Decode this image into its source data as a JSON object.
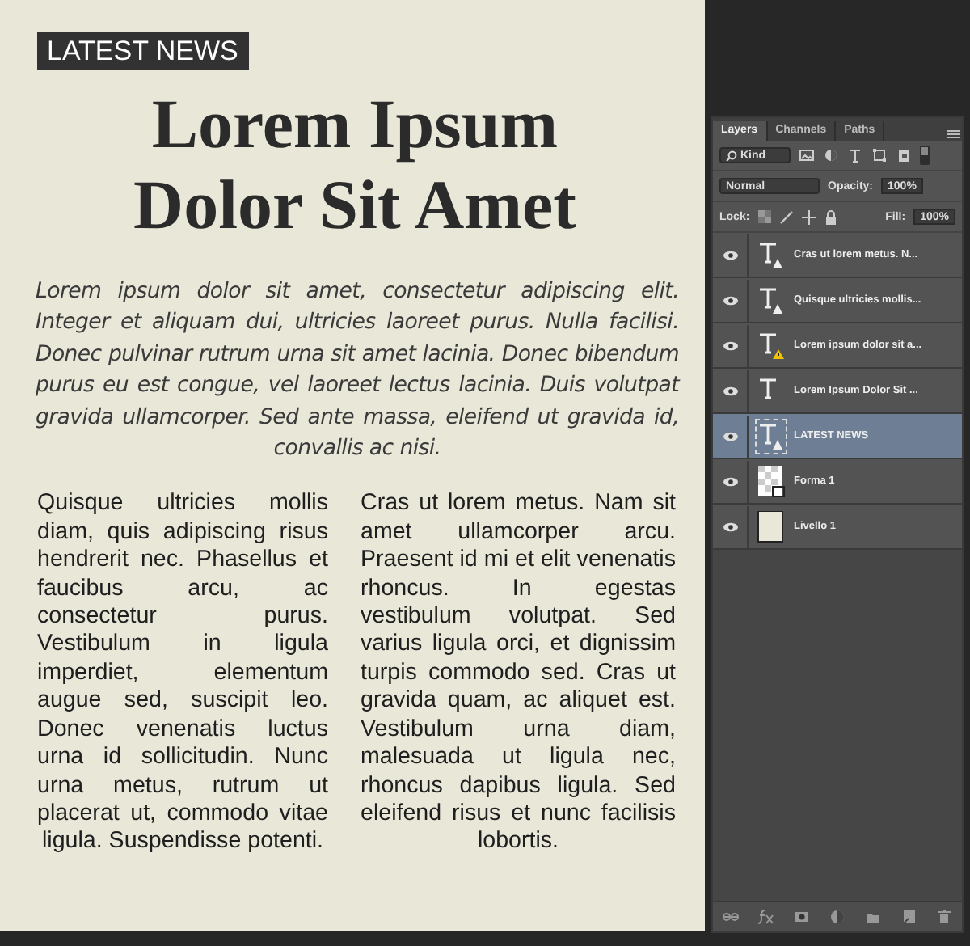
{
  "document": {
    "badge": "LATEST NEWS",
    "headline": [
      "Lorem Ipsum",
      "Dolor Sit Amet"
    ],
    "intro": "Lorem ipsum dolor sit amet, consectetur adipiscing elit. Integer et aliquam dui, ultricies laoreet purus. Nulla facilisi. Donec pulvinar rutrum urna sit amet lacinia. Donec bibendum purus eu est congue, vel laoreet lectus lacinia. Duis volutpat gravida ullamcorper. Sed ante massa, eleifend ut gravida id, convallis ac nisi.",
    "columns": [
      "Quisque ultricies mollis diam, quis adipiscing risus hendrerit nec. Phasellus et faucibus arcu, ac consectetur purus. Vestibulum in ligula imperdiet, elementum augue sed, suscipit leo. Donec venenatis luctus urna id sollicitudin. Nunc urna metus, rutrum ut placerat ut, commodo vitae ligula. Suspendisse potenti.",
      "Cras ut lorem metus. Nam sit amet ullamcorper arcu. Praesent id mi et elit venenatis rhoncus. In egestas vestibulum volutpat. Sed varius ligula orci, et dignissim turpis commodo sed. Cras ut gravida quam, ac aliquet est. Vestibulum urna diam, malesuada ut ligula nec, rhoncus dapibus ligula. Sed eleifend risus et nunc facilisis lobortis."
    ]
  },
  "layers_panel": {
    "tabs": [
      {
        "label": "Layers",
        "selected": true
      },
      {
        "label": "Channels",
        "selected": false
      },
      {
        "label": "Paths",
        "selected": false
      }
    ],
    "filter": "Kind",
    "blend_mode": "Normal",
    "opacity_label": "Opacity:",
    "opacity": "100%",
    "lock_label": "Lock:",
    "fill_label": "Fill:",
    "fill": "100%",
    "layers": [
      {
        "name": "Cras ut lorem metus. N...",
        "kind": "text",
        "visible": true,
        "selected": false
      },
      {
        "name": "Quisque ultricies mollis...",
        "kind": "text",
        "visible": true,
        "selected": false
      },
      {
        "name": "Lorem ipsum dolor sit a...",
        "kind": "text-warning",
        "visible": true,
        "selected": false
      },
      {
        "name": "Lorem Ipsum Dolor Sit ...",
        "kind": "text-plain",
        "visible": true,
        "selected": false
      },
      {
        "name": "LATEST NEWS",
        "kind": "text",
        "visible": true,
        "selected": true
      },
      {
        "name": "Forma 1",
        "kind": "shape",
        "visible": true,
        "selected": false
      },
      {
        "name": "Livello 1",
        "kind": "fill",
        "visible": true,
        "selected": false
      }
    ]
  }
}
